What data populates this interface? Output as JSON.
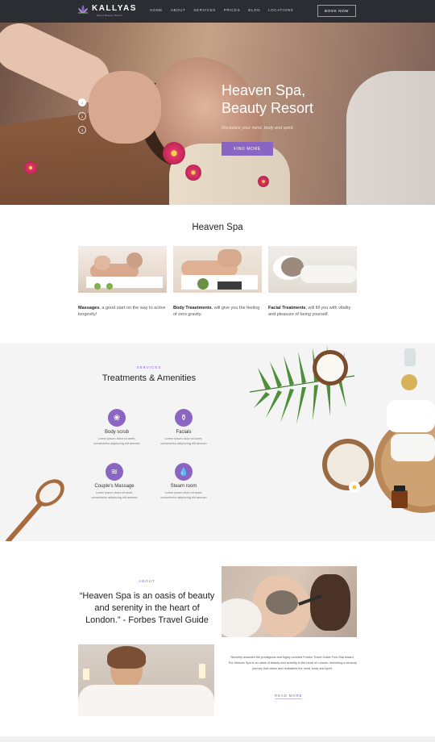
{
  "header": {
    "logo": "KALLYAS",
    "tagline": "Spa & Beauty Resort",
    "nav": [
      "HOME",
      "ABOUT",
      "SERVICES",
      "PRICES",
      "BLOG",
      "LOCATIONS"
    ],
    "cta": "BOOK NOW"
  },
  "hero": {
    "title_line1": "Heaven Spa,",
    "title_line2": "Beauty Resort",
    "subtitle": "Revitalize your mind, body and spirit.",
    "button": "FIND MORE",
    "slides": [
      "1",
      "2",
      "3"
    ]
  },
  "spa": {
    "title": "Heaven Spa",
    "cards": [
      {
        "bold": "Massages",
        "text": ", a good start on the way to active longevity!"
      },
      {
        "bold": "Body Treaetments",
        "text": ", will give you the feeling of zero gravity."
      },
      {
        "bold": "Facial Treatments",
        "text": ", will fill you with vitality and pleasure of being yourself."
      }
    ]
  },
  "treatments": {
    "eyebrow": "SERVICES",
    "title": "Treatments & Amenities",
    "items": [
      {
        "name": "Body scrub",
        "desc1": "Lorem ipsum dolor sit amet,",
        "desc2": "consectetur adipiscing elit aenean"
      },
      {
        "name": "Facials",
        "desc1": "Lorem ipsum dolor sit amet,",
        "desc2": "consectetur adipiscing elit aenean"
      },
      {
        "name": "Couple's Massage",
        "desc1": "Lorem ipsum dolor sit amet,",
        "desc2": "consectetur adipiscing elit aenean"
      },
      {
        "name": "Steam room",
        "desc1": "Lorem ipsum dolor sit amet,",
        "desc2": "consectetur adipiscing elit aenean"
      }
    ]
  },
  "about": {
    "eyebrow": "ABOUT",
    "quote": "“Heaven Spa is an oasis of beauty and serenity in the heart of London.” - Forbes Travel Guide",
    "text": "Recently awarded the prestigious and highly coveted Forbes Travel Guide Five-Star Award, The Heaven Spa is an oasis of beauty and serenity in the heart of London, delivering a sensory journey that calms and revitalizes the mind, body and spirit.",
    "button": "READ MORE"
  },
  "colors": {
    "accent": "#8b65c2",
    "header_bg": "#2b2d33",
    "section_bg": "#f4f4f5"
  }
}
